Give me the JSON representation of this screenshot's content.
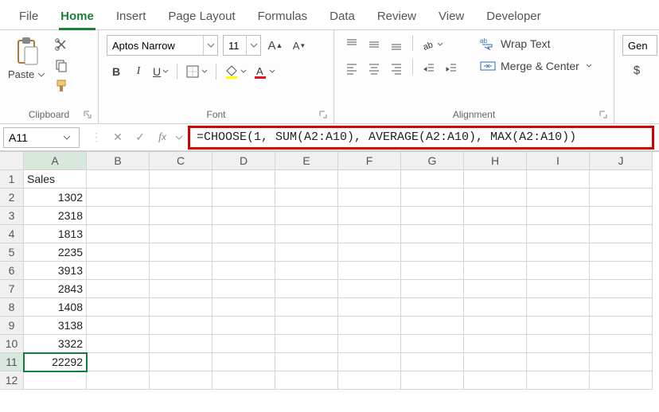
{
  "tabs": [
    "File",
    "Home",
    "Insert",
    "Page Layout",
    "Formulas",
    "Data",
    "Review",
    "View",
    "Developer"
  ],
  "active_tab": "Home",
  "ribbon": {
    "clipboard": {
      "label": "Clipboard",
      "paste": "Paste"
    },
    "font": {
      "label": "Font",
      "name": "Aptos Narrow",
      "size": "11",
      "bold": "B",
      "italic": "I",
      "underline": "U"
    },
    "alignment": {
      "label": "Alignment",
      "wrap": "Wrap Text",
      "merge": "Merge & Center"
    },
    "number": {
      "format": "Gen"
    }
  },
  "namebox": "A11",
  "formula": "=CHOOSE(1, SUM(A2:A10), AVERAGE(A2:A10), MAX(A2:A10))",
  "columns": [
    "A",
    "B",
    "C",
    "D",
    "E",
    "F",
    "G",
    "H",
    "I",
    "J"
  ],
  "rows": [
    1,
    2,
    3,
    4,
    5,
    6,
    7,
    8,
    9,
    10,
    11,
    12
  ],
  "cells": {
    "A1": "Sales",
    "A2": "1302",
    "A3": "2318",
    "A4": "1813",
    "A5": "2235",
    "A6": "3913",
    "A7": "2843",
    "A8": "1408",
    "A9": "3138",
    "A10": "3322",
    "A11": "22292"
  },
  "selected": "A11",
  "chart_data": {
    "type": "table",
    "title": "Sales",
    "categories": [
      "A2",
      "A3",
      "A4",
      "A5",
      "A6",
      "A7",
      "A8",
      "A9",
      "A10",
      "A11"
    ],
    "values": [
      1302,
      2318,
      1813,
      2235,
      3913,
      2843,
      1408,
      3138,
      3322,
      22292
    ],
    "note": "A11 = SUM(A2:A10) via CHOOSE index 1"
  }
}
